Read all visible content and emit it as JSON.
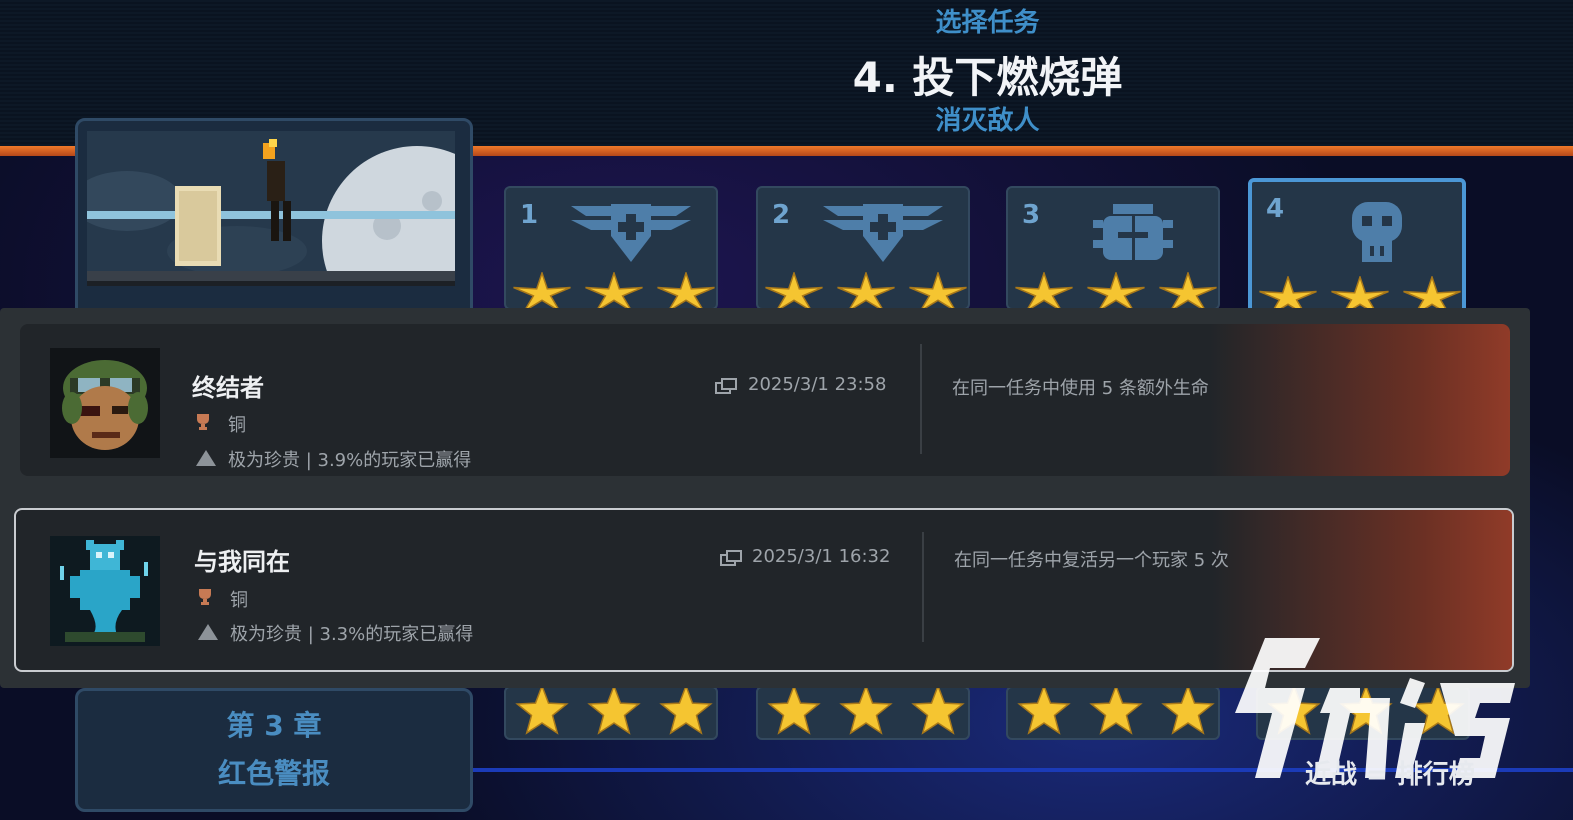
{
  "header": {
    "select_label": "选择任务",
    "mission_title": "4. 投下燃烧弹",
    "mission_subtitle": "消灭敌人"
  },
  "chapter": {
    "number_label": "第 3 章",
    "name": "红色警报"
  },
  "missions": [
    {
      "number": "1",
      "icon": "winged-medic-icon",
      "stars": 3
    },
    {
      "number": "2",
      "icon": "winged-medic-icon",
      "stars": 3
    },
    {
      "number": "3",
      "icon": "beetle-icon",
      "stars": 3
    },
    {
      "number": "4",
      "icon": "skull-icon",
      "stars": 3,
      "selected": true
    }
  ],
  "trophies": [
    {
      "name": "终结者",
      "grade": "铜",
      "rarity": "极为珍贵 | 3.9%的玩家已赢得",
      "date": "2025/3/1  23:58",
      "description": "在同一任务中使用 5 条额外生命",
      "avatar": "soldier-avatar"
    },
    {
      "name": "与我同在",
      "grade": "铜",
      "rarity": "极为珍贵 | 3.3%的玩家已赢得",
      "date": "2025/3/1  16:32",
      "description": "在同一任务中复活另一个玩家 5 次",
      "avatar": "ghost-avatar"
    }
  ],
  "footer": {
    "hint": "近战 = 排行榜"
  },
  "colors": {
    "accent_orange": "#f07a2a",
    "title_blue": "#3f8fc9",
    "star_gold": "#f5c531",
    "trophy_bronze": "#c77a54"
  }
}
